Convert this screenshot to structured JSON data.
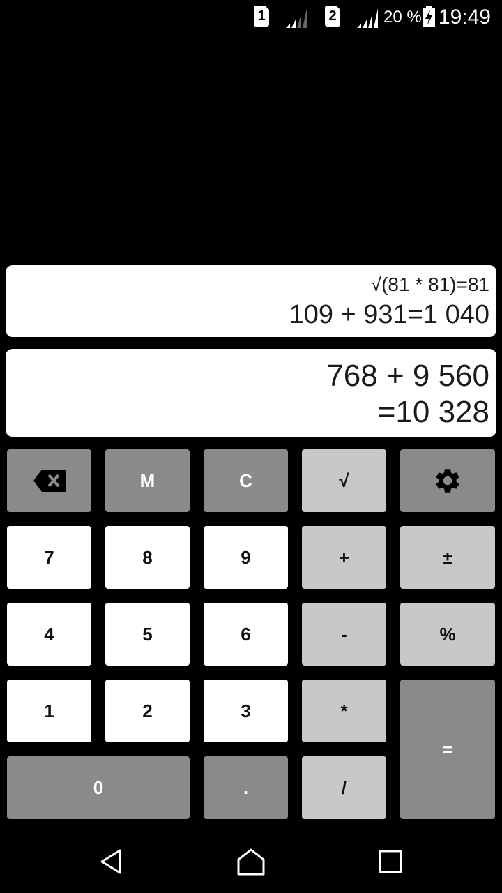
{
  "status_bar": {
    "sim1_label": "1",
    "sim2_label": "2",
    "battery_text": "20 %",
    "time": "19:49"
  },
  "history": {
    "line1": "√(81 * 81)=81",
    "line2": "109 + 931=1 040"
  },
  "display": {
    "expression": "768 + 9 560",
    "result": "=10 328"
  },
  "keys": {
    "backspace_icon": "backspace-icon",
    "memory": "M",
    "clear": "C",
    "sqrt": "√",
    "settings_icon": "gear-icon",
    "seven": "7",
    "eight": "8",
    "nine": "9",
    "plus": "+",
    "plus_minus": "±",
    "four": "4",
    "five": "5",
    "six": "6",
    "minus": "-",
    "percent": "%",
    "one": "1",
    "two": "2",
    "three": "3",
    "multiply": "*",
    "equals": "=",
    "zero": "0",
    "dot": ".",
    "divide": "/"
  },
  "nav": {
    "back_icon": "back-icon",
    "home_icon": "home-icon",
    "recents_icon": "recents-icon"
  },
  "colors": {
    "background": "#000000",
    "key_white": "#ffffff",
    "key_light": "#c8c8c8",
    "key_dark": "#8a8a8a"
  }
}
